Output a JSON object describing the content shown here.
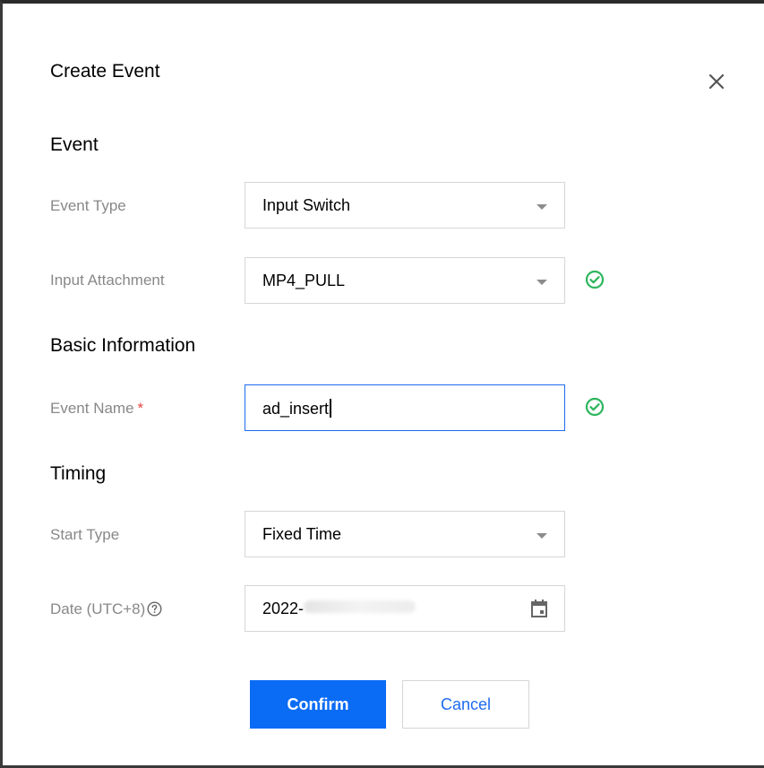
{
  "dialog": {
    "title": "Create Event",
    "close_icon": "close-icon"
  },
  "sections": {
    "event": "Event",
    "basic": "Basic Information",
    "timing": "Timing"
  },
  "fields": {
    "event_type": {
      "label": "Event Type",
      "value": "Input Switch",
      "icon": "chevron-down-icon"
    },
    "input_attachment": {
      "label": "Input Attachment",
      "value": "MP4_PULL",
      "icon": "chevron-down-icon",
      "status_icon": "check-circle-icon"
    },
    "event_name": {
      "label": "Event Name",
      "required_mark": "*",
      "value": "ad_insert",
      "status_icon": "check-circle-icon"
    },
    "start_type": {
      "label": "Start Type",
      "value": "Fixed Time",
      "icon": "chevron-down-icon"
    },
    "date": {
      "label": "Date (UTC+8)",
      "value": "2022-",
      "help_icon": "question-circle-icon",
      "icon": "calendar-icon"
    }
  },
  "buttons": {
    "confirm": "Confirm",
    "cancel": "Cancel"
  },
  "colors": {
    "primary": "#0a6cf5",
    "success": "#2db55d",
    "required": "#e54545",
    "label": "#888888",
    "active_border": "#1e6bf0"
  }
}
